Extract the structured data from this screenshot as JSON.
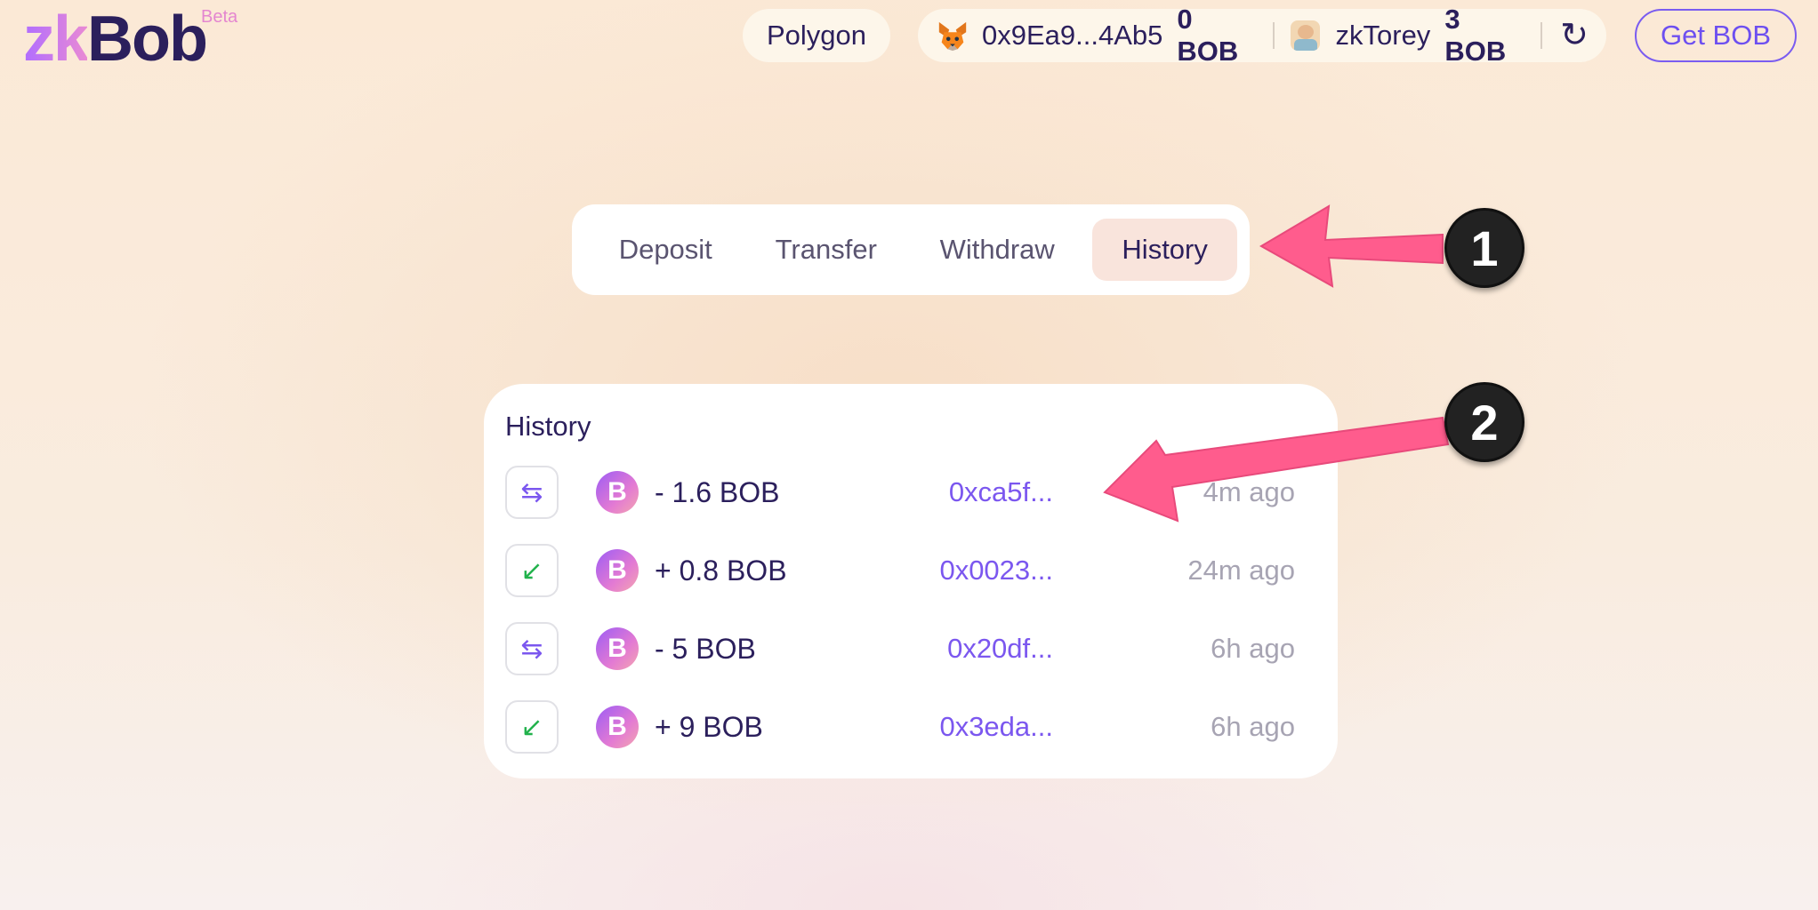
{
  "header": {
    "logo": {
      "zk": "zk",
      "bob": "Bob",
      "beta": "Beta"
    },
    "network": "Polygon",
    "wallet": {
      "address": "0x9Ea9...4Ab5",
      "balance": "0 BOB"
    },
    "account": {
      "name": "zkTorey",
      "balance": "3 BOB"
    },
    "get_bob": "Get BOB"
  },
  "tabs": [
    {
      "label": "Deposit"
    },
    {
      "label": "Transfer"
    },
    {
      "label": "Withdraw"
    },
    {
      "label": "History",
      "active": true
    }
  ],
  "history": {
    "title": "History",
    "rows": [
      {
        "direction": "transfer-icon",
        "amount": "- 1.6 BOB",
        "hash": "0xca5f...",
        "time": "4m ago"
      },
      {
        "direction": "incoming-icon",
        "amount": "+ 0.8 BOB",
        "hash": "0x0023...",
        "time": "24m ago"
      },
      {
        "direction": "transfer-icon",
        "amount": "- 5 BOB",
        "hash": "0x20df...",
        "time": "6h ago"
      },
      {
        "direction": "incoming-icon",
        "amount": "+ 9 BOB",
        "hash": "0x3eda...",
        "time": "6h ago"
      }
    ]
  },
  "annotations": {
    "badge1": "1",
    "badge2": "2",
    "arrow_color": "#ff5c8d"
  },
  "colors": {
    "accent": "#7b57ef",
    "positive": "#22b24c",
    "text": "#2b1f5c"
  }
}
